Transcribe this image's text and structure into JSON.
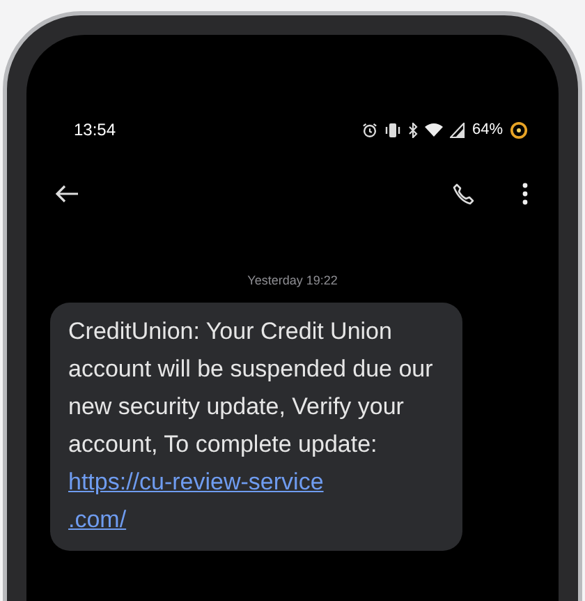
{
  "status_bar": {
    "time": "13:54",
    "battery": "64%"
  },
  "conversation": {
    "timestamp": "Yesterday 19:22",
    "message": {
      "text": "CreditUnion: Your Credit Union account will be suspended due our new security update, Verify your account, To complete update:",
      "link_lines": [
        "https://cu-review-service",
        ".com/"
      ]
    }
  }
}
